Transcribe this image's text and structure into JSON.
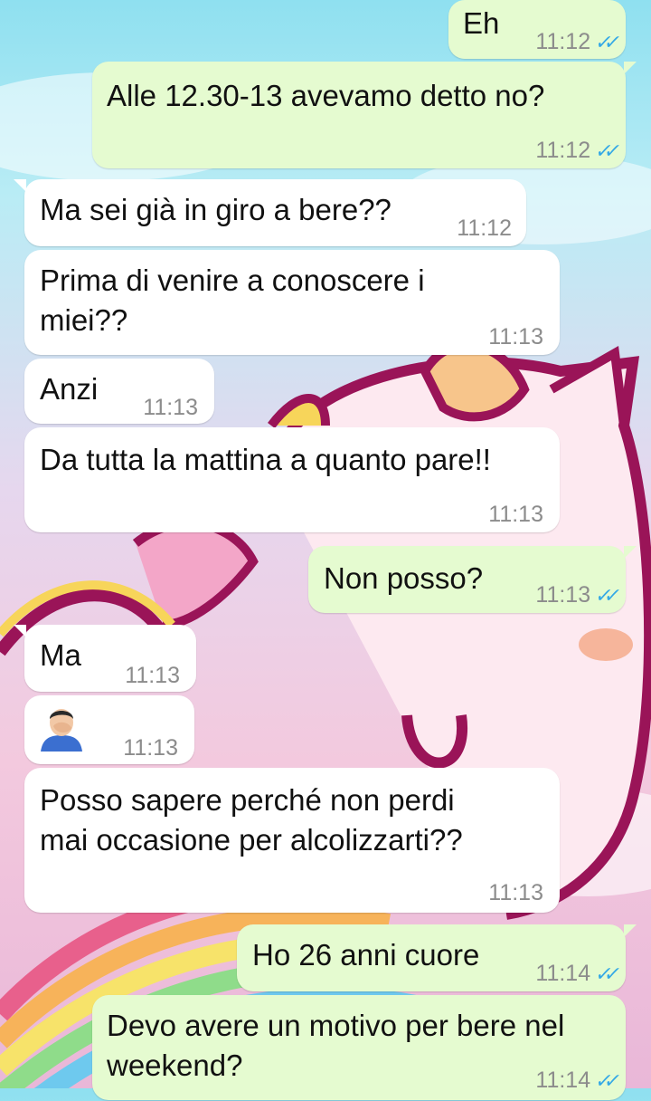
{
  "messages": [
    {
      "id": "m1",
      "dir": "out",
      "text": "Eh",
      "time": "11:12",
      "status": "read"
    },
    {
      "id": "m2",
      "dir": "out",
      "text": "Alle 12.30-13 avevamo detto no?",
      "time": "11:12",
      "status": "read"
    },
    {
      "id": "m3",
      "dir": "in",
      "text": "Ma sei già in giro a bere??",
      "time": "11:12"
    },
    {
      "id": "m4",
      "dir": "in",
      "text": "Prima di venire a conoscere i\nmiei??",
      "time": "11:13"
    },
    {
      "id": "m5",
      "dir": "in",
      "text": "Anzi",
      "time": "11:13"
    },
    {
      "id": "m6",
      "dir": "in",
      "text": "Da tutta la mattina a quanto pare!!",
      "time": "11:13"
    },
    {
      "id": "m7",
      "dir": "out",
      "text": "Non posso?",
      "time": "11:13",
      "status": "read"
    },
    {
      "id": "m8",
      "dir": "in",
      "text": "Ma",
      "time": "11:13"
    },
    {
      "id": "m9",
      "dir": "in",
      "text": "",
      "emoji": "man-facepalming",
      "time": "11:13"
    },
    {
      "id": "m10",
      "dir": "in",
      "text": "Posso sapere perché non perdi\nmai occasione per alcolizzarti??",
      "time": "11:13"
    },
    {
      "id": "m11",
      "dir": "out",
      "text": "Ho 26 anni cuore",
      "time": "11:14",
      "status": "read"
    },
    {
      "id": "m12",
      "dir": "out",
      "text": "Devo avere un motivo per bere nel\nweekend?",
      "time": "11:14",
      "status": "read"
    }
  ],
  "colors": {
    "incoming_bubble": "#ffffff",
    "outgoing_bubble": "#e5fbd0",
    "read_ticks": "#33a8e6",
    "wallpaper_outline": "#9a1458"
  },
  "wallpaper": "unicorn-rainbow"
}
